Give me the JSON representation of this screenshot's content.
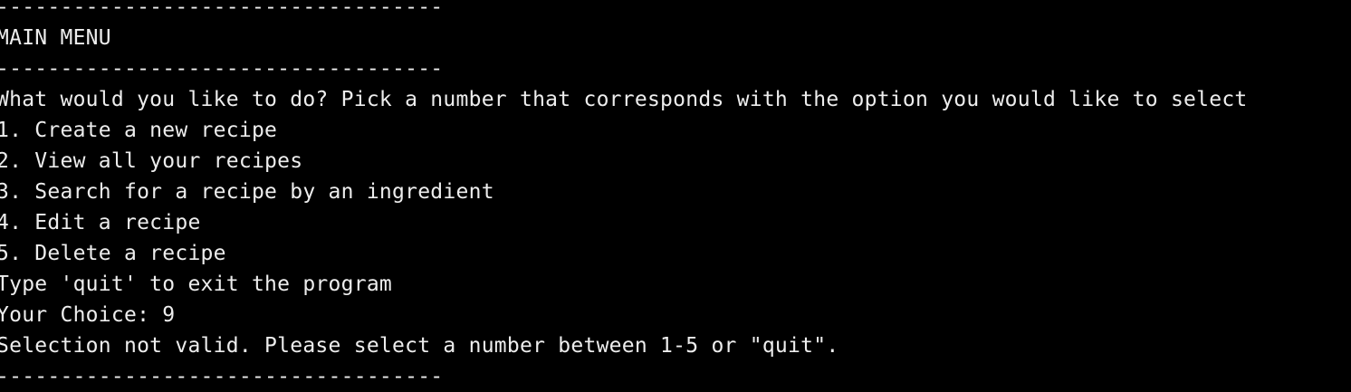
{
  "terminal": {
    "divider": "-----------------------------------",
    "menu_title": "MAIN MENU",
    "prompt": "What would you like to do? Pick a number that corresponds with the option you would like to select",
    "options": [
      "1. Create a new recipe",
      "2. View all your recipes",
      "3. Search for a recipe by an ingredient",
      "4. Edit a recipe",
      "5. Delete a recipe"
    ],
    "quit_hint": "Type 'quit' to exit the program",
    "choice_label": "Your Choice: ",
    "choice_value": "9",
    "error_message": "Selection not valid. Please select a number between 1-5 or \"quit\"."
  },
  "colors": {
    "background": "#000000",
    "text": "#ededed"
  }
}
